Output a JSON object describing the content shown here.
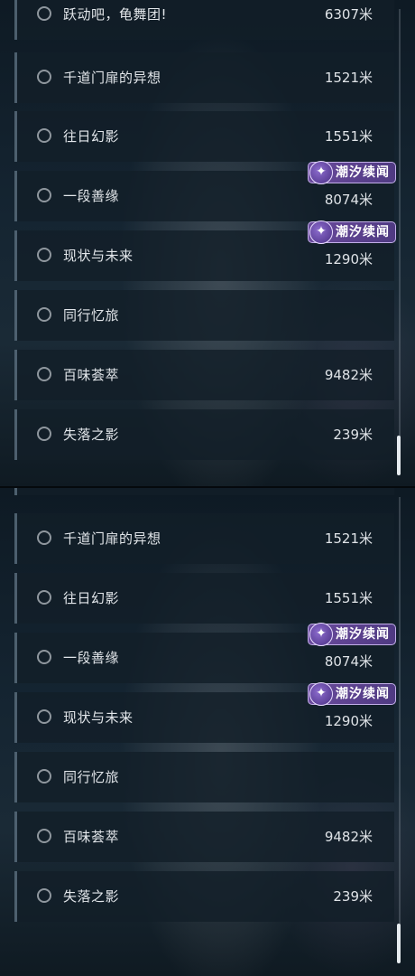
{
  "screens": [
    {
      "rows": [
        {
          "title": "跃动吧，龟舞团!",
          "distance": "6307米"
        },
        {
          "title": "千道门扉的异想",
          "distance": "1521米"
        },
        {
          "title": "往日幻影",
          "distance": "1551米"
        },
        {
          "title": "一段善缘",
          "distance": "8074米",
          "badge": "潮汐续闻"
        },
        {
          "title": "现状与未来",
          "distance": "1290米",
          "badge": "潮汐续闻"
        },
        {
          "title": "同行忆旅",
          "distance": ""
        },
        {
          "title": "百味荟萃",
          "distance": "9482米"
        },
        {
          "title": "失落之影",
          "distance": "239米"
        }
      ]
    },
    {
      "rows": [
        {
          "title": "千道门扉的异想",
          "distance": "1521米"
        },
        {
          "title": "往日幻影",
          "distance": "1551米"
        },
        {
          "title": "一段善缘",
          "distance": "8074米",
          "badge": "潮汐续闻"
        },
        {
          "title": "现状与未来",
          "distance": "1290米",
          "badge": "潮汐续闻"
        },
        {
          "title": "同行忆旅",
          "distance": ""
        },
        {
          "title": "百味荟萃",
          "distance": "9482米"
        },
        {
          "title": "失落之影",
          "distance": "239米"
        }
      ]
    }
  ],
  "badge_icon": "feather-swirl-icon",
  "colors": {
    "badge_fill": "#5f4494",
    "badge_border": "#c2aee8",
    "row_fill": "#121e28",
    "text": "#e2e6ea",
    "radio": "#8f979e"
  }
}
